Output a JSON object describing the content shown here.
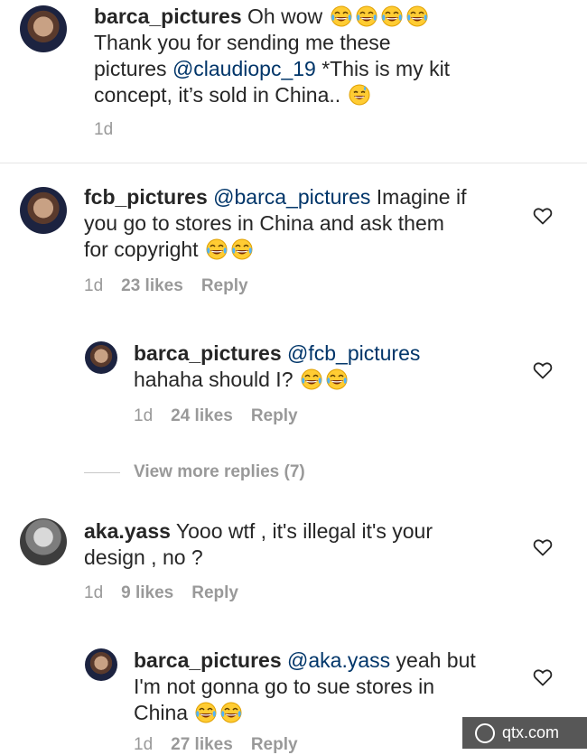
{
  "comments": [
    {
      "username": "barca_pictures",
      "text_1": " Oh wow ",
      "text_2": "Thank you for sending me these",
      "text_3a": "pictures ",
      "mention": "@claudiopc_19",
      "text_3b": " *This is my kit",
      "text_4": "concept, it’s sold in China.. ",
      "time": "1d"
    },
    {
      "username": "fcb_pictures",
      "mention": "@barca_pictures",
      "text_1": " Imagine if",
      "text_2": "you go to stores in China and ask them",
      "text_3": "for copyright ",
      "time": "1d",
      "likes": "23 likes",
      "reply": "Reply"
    },
    {
      "username": "barca_pictures",
      "mention": "@fcb_pictures",
      "text_2": "hahaha should I? ",
      "time": "1d",
      "likes": "24 likes",
      "reply": "Reply"
    },
    {
      "username": "aka.yass",
      "text_1": " Yooo wtf , it's illegal it's your",
      "text_2": "design , no ?",
      "time": "1d",
      "likes": "9 likes",
      "reply": "Reply"
    },
    {
      "username": "barca_pictures",
      "mention": "@aka.yass",
      "text_1": " yeah but",
      "text_2": "I'm not gonna  go to sue stores in",
      "text_3": "China ",
      "time": "1d",
      "likes": "27 likes",
      "reply": "Reply"
    }
  ],
  "view_more": "View more replies (7)",
  "watermark": "qtx.com",
  "icons": {
    "like": "heart-outline-icon",
    "emoji_laugh": "face-with-tears-of-joy-emoji",
    "emoji_sweat": "grinning-face-with-sweat-emoji"
  },
  "colors": {
    "mention": "#003569",
    "meta": "#999999",
    "text": "#262626"
  }
}
